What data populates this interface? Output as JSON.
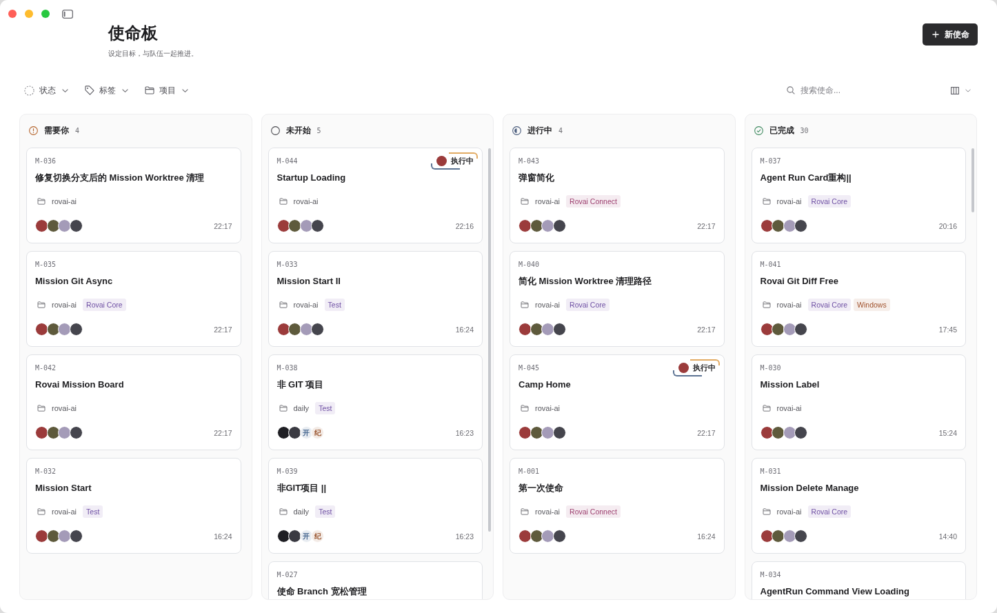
{
  "header": {
    "title": "使命板",
    "subtitle": "设定目标，与队伍一起推进。",
    "new_button": "新使命"
  },
  "filters": [
    {
      "kind": "status",
      "label": "状态"
    },
    {
      "kind": "tag",
      "label": "标签"
    },
    {
      "kind": "project",
      "label": "项目"
    }
  ],
  "search": {
    "placeholder": "搜索使命..."
  },
  "columns": [
    {
      "kind": "attention",
      "title": "需要你",
      "count": "4",
      "cards": [
        {
          "id": "M-036",
          "title": "修复切换分支后的 Mission Worktree 清理",
          "project": "rovai-ai",
          "avatars": [
            {
              "kind": "photo",
              "color": "#9b3b3b"
            },
            {
              "kind": "photo",
              "color": "#5e5a3c"
            },
            {
              "kind": "photo",
              "color": "#a49bb8"
            },
            {
              "kind": "photo",
              "color": "#45454d"
            }
          ],
          "time": "22:17"
        },
        {
          "id": "M-035",
          "title": "Mission Git Async",
          "project": "rovai-ai",
          "tags": [
            {
              "label": "Rovai Core",
              "color": "#6e4fa3"
            }
          ],
          "avatars": [
            {
              "kind": "photo",
              "color": "#9b3b3b"
            },
            {
              "kind": "photo",
              "color": "#5e5a3c"
            },
            {
              "kind": "photo",
              "color": "#a49bb8"
            },
            {
              "kind": "photo",
              "color": "#45454d"
            }
          ],
          "time": "22:17"
        },
        {
          "id": "M-042",
          "title": "Rovai Mission Board",
          "project": "rovai-ai",
          "avatars": [
            {
              "kind": "photo",
              "color": "#9b3b3b"
            },
            {
              "kind": "photo",
              "color": "#5e5a3c"
            },
            {
              "kind": "photo",
              "color": "#a49bb8"
            },
            {
              "kind": "photo",
              "color": "#45454d"
            }
          ],
          "time": "22:17"
        },
        {
          "id": "M-032",
          "title": "Mission Start",
          "project": "rovai-ai",
          "tags": [
            {
              "label": "Test",
              "color": "#6e4fa3"
            }
          ],
          "avatars": [
            {
              "kind": "photo",
              "color": "#9b3b3b"
            },
            {
              "kind": "photo",
              "color": "#5e5a3c"
            },
            {
              "kind": "photo",
              "color": "#a49bb8"
            },
            {
              "kind": "photo",
              "color": "#45454d"
            }
          ],
          "time": "16:24"
        }
      ]
    },
    {
      "kind": "todo",
      "title": "未开始",
      "count": "5",
      "cards": [
        {
          "id": "M-044",
          "title": "Startup Loading",
          "project": "rovai-ai",
          "agent": {
            "label": "执行中",
            "avatar": {
              "color": "#9b3b3b"
            }
          },
          "avatars": [
            {
              "kind": "photo",
              "color": "#9b3b3b"
            },
            {
              "kind": "photo",
              "color": "#5e5a3c"
            },
            {
              "kind": "photo",
              "color": "#a49bb8"
            },
            {
              "kind": "photo",
              "color": "#45454d"
            }
          ],
          "time": "22:16"
        },
        {
          "id": "M-033",
          "title": "Mission Start II",
          "project": "rovai-ai",
          "tags": [
            {
              "label": "Test",
              "color": "#6e4fa3"
            }
          ],
          "avatars": [
            {
              "kind": "photo",
              "color": "#9b3b3b"
            },
            {
              "kind": "photo",
              "color": "#5e5a3c"
            },
            {
              "kind": "photo",
              "color": "#a49bb8"
            },
            {
              "kind": "photo",
              "color": "#45454d"
            }
          ],
          "time": "16:24"
        },
        {
          "id": "M-038",
          "title": "非 GIT 项目",
          "project": "daily",
          "tags": [
            {
              "label": "Test",
              "color": "#6e4fa3"
            }
          ],
          "avatars": [
            {
              "kind": "photo",
              "color": "#1f1f24"
            },
            {
              "kind": "photo",
              "color": "#3a3a42"
            },
            {
              "kind": "initial",
              "text": "开",
              "color": "#3d5f8a"
            },
            {
              "kind": "initial",
              "text": "纪",
              "color": "#9a5630"
            }
          ],
          "time": "16:23"
        },
        {
          "id": "M-039",
          "title": "非GIT项目 ||",
          "project": "daily",
          "tags": [
            {
              "label": "Test",
              "color": "#6e4fa3"
            }
          ],
          "avatars": [
            {
              "kind": "photo",
              "color": "#1f1f24"
            },
            {
              "kind": "photo",
              "color": "#3a3a42"
            },
            {
              "kind": "initial",
              "text": "开",
              "color": "#3d5f8a"
            },
            {
              "kind": "initial",
              "text": "纪",
              "color": "#9a5630"
            }
          ],
          "time": "16:23"
        },
        {
          "id": "M-027",
          "title": "使命 Branch 宽松管理"
        }
      ]
    },
    {
      "kind": "in_progress",
      "title": "进行中",
      "count": "4",
      "cards": [
        {
          "id": "M-043",
          "title": "弹窗简化",
          "project": "rovai-ai",
          "tags": [
            {
              "label": "Rovai Connect",
              "color": "#9c3f6e"
            }
          ],
          "avatars": [
            {
              "kind": "photo",
              "color": "#9b3b3b"
            },
            {
              "kind": "photo",
              "color": "#5e5a3c"
            },
            {
              "kind": "photo",
              "color": "#a49bb8"
            },
            {
              "kind": "photo",
              "color": "#45454d"
            }
          ],
          "time": "22:17"
        },
        {
          "id": "M-040",
          "title": "简化 Mission Worktree 清理路径",
          "project": "rovai-ai",
          "tags": [
            {
              "label": "Rovai Core",
              "color": "#6e4fa3"
            }
          ],
          "avatars": [
            {
              "kind": "photo",
              "color": "#9b3b3b"
            },
            {
              "kind": "photo",
              "color": "#5e5a3c"
            },
            {
              "kind": "photo",
              "color": "#a49bb8"
            },
            {
              "kind": "photo",
              "color": "#45454d"
            }
          ],
          "time": "22:17"
        },
        {
          "id": "M-045",
          "title": "Camp Home",
          "project": "rovai-ai",
          "agent": {
            "label": "执行中",
            "avatar": {
              "color": "#9b3b3b"
            }
          },
          "avatars": [
            {
              "kind": "photo",
              "color": "#9b3b3b"
            },
            {
              "kind": "photo",
              "color": "#5e5a3c"
            },
            {
              "kind": "photo",
              "color": "#a49bb8"
            },
            {
              "kind": "photo",
              "color": "#45454d"
            }
          ],
          "time": "22:17"
        },
        {
          "id": "M-001",
          "title": "第一次使命",
          "project": "rovai-ai",
          "tags": [
            {
              "label": "Rovai Connect",
              "color": "#9c3f6e"
            }
          ],
          "avatars": [
            {
              "kind": "photo",
              "color": "#9b3b3b"
            },
            {
              "kind": "photo",
              "color": "#5e5a3c"
            },
            {
              "kind": "photo",
              "color": "#a49bb8"
            },
            {
              "kind": "photo",
              "color": "#45454d"
            }
          ],
          "time": "16:24"
        }
      ]
    },
    {
      "kind": "done",
      "title": "已完成",
      "count": "30",
      "cards": [
        {
          "id": "M-037",
          "title": "Agent Run Card重构||",
          "project": "rovai-ai",
          "tags": [
            {
              "label": "Rovai Core",
              "color": "#6e4fa3"
            }
          ],
          "avatars": [
            {
              "kind": "photo",
              "color": "#9b3b3b"
            },
            {
              "kind": "photo",
              "color": "#5e5a3c"
            },
            {
              "kind": "photo",
              "color": "#a49bb8"
            },
            {
              "kind": "photo",
              "color": "#45454d"
            }
          ],
          "time": "20:16"
        },
        {
          "id": "M-041",
          "title": "Rovai Git Diff Free",
          "project": "rovai-ai",
          "tags": [
            {
              "label": "Rovai Core",
              "color": "#6e4fa3"
            },
            {
              "label": "Windows",
              "color": "#a0522d"
            }
          ],
          "avatars": [
            {
              "kind": "photo",
              "color": "#9b3b3b"
            },
            {
              "kind": "photo",
              "color": "#5e5a3c"
            },
            {
              "kind": "photo",
              "color": "#a49bb8"
            },
            {
              "kind": "photo",
              "color": "#45454d"
            }
          ],
          "time": "17:45"
        },
        {
          "id": "M-030",
          "title": "Mission Label",
          "project": "rovai-ai",
          "avatars": [
            {
              "kind": "photo",
              "color": "#9b3b3b"
            },
            {
              "kind": "photo",
              "color": "#5e5a3c"
            },
            {
              "kind": "photo",
              "color": "#a49bb8"
            },
            {
              "kind": "photo",
              "color": "#45454d"
            }
          ],
          "time": "15:24"
        },
        {
          "id": "M-031",
          "title": "Mission Delete Manage",
          "project": "rovai-ai",
          "tags": [
            {
              "label": "Rovai Core",
              "color": "#6e4fa3"
            }
          ],
          "avatars": [
            {
              "kind": "photo",
              "color": "#9b3b3b"
            },
            {
              "kind": "photo",
              "color": "#5e5a3c"
            },
            {
              "kind": "photo",
              "color": "#a49bb8"
            },
            {
              "kind": "photo",
              "color": "#45454d"
            }
          ],
          "time": "14:40"
        },
        {
          "id": "M-034",
          "title": "AgentRun Command View Loading"
        }
      ]
    }
  ]
}
